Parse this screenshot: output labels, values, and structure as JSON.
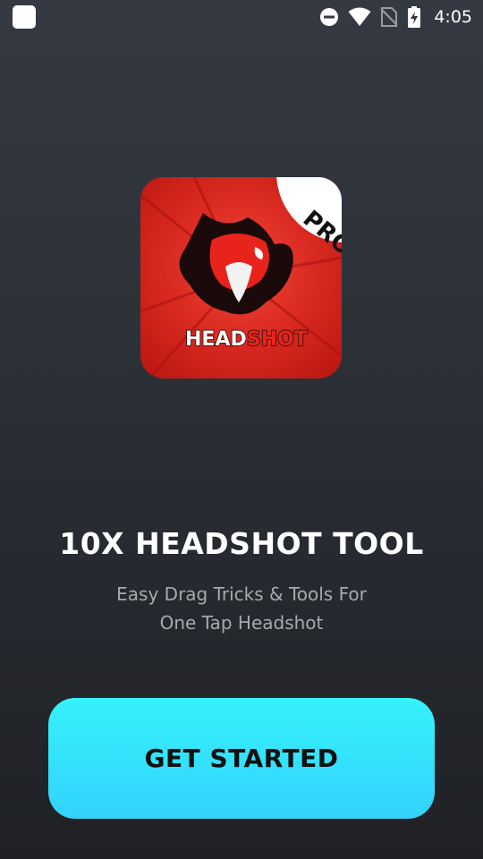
{
  "status_bar": {
    "time": "4:05",
    "icons": [
      "app-notification-icon",
      "do-not-disturb-icon",
      "wifi-icon",
      "no-sim-icon",
      "battery-charging-icon"
    ]
  },
  "app": {
    "logo_text_head": "HEAD",
    "logo_text_shot": "SHOT",
    "logo_badge": "PRO",
    "title": "10X HEADSHOT TOOL",
    "subtitle_line1": "Easy Drag Tricks & Tools For",
    "subtitle_line2": "One Tap Headshot"
  },
  "actions": {
    "get_started_label": "GET STARTED"
  },
  "colors": {
    "background_top": "#353a42",
    "background_bottom": "#1f2125",
    "button": "#34e4fb",
    "logo_red": "#dc2b22",
    "subtitle": "#a7a9ad"
  }
}
